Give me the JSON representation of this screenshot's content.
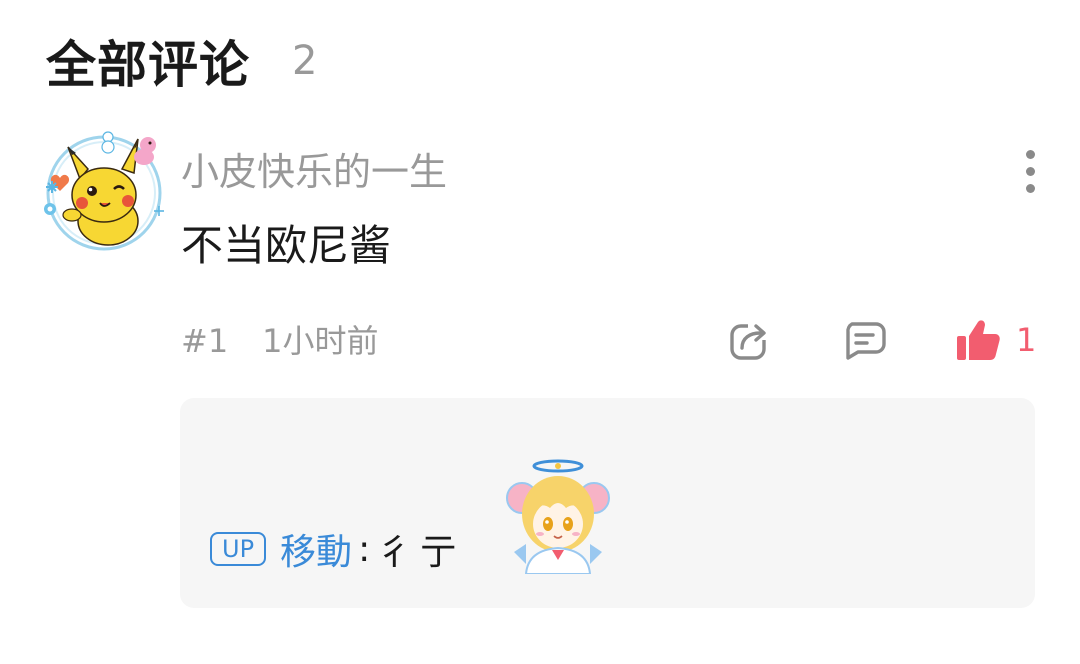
{
  "header": {
    "title": "全部评论",
    "count": "2"
  },
  "comment": {
    "avatar_icon": "pikachu-avatar",
    "username": "小皮快乐的一生",
    "text": "不当欧尼酱",
    "floor": "#1",
    "time": "1小时前",
    "like_count": "1",
    "liked": true,
    "like_color": "#f25d6f",
    "icons": {
      "more": "more-vertical-icon",
      "share": "share-icon",
      "reply": "comment-icon",
      "like": "thumbs-up-icon"
    },
    "reply": {
      "badge": "UP",
      "author": "移動",
      "colon": ":",
      "text": "彳亍",
      "sticker": "anime-angel-girl-sticker",
      "author_color": "#3a8ad8"
    }
  }
}
